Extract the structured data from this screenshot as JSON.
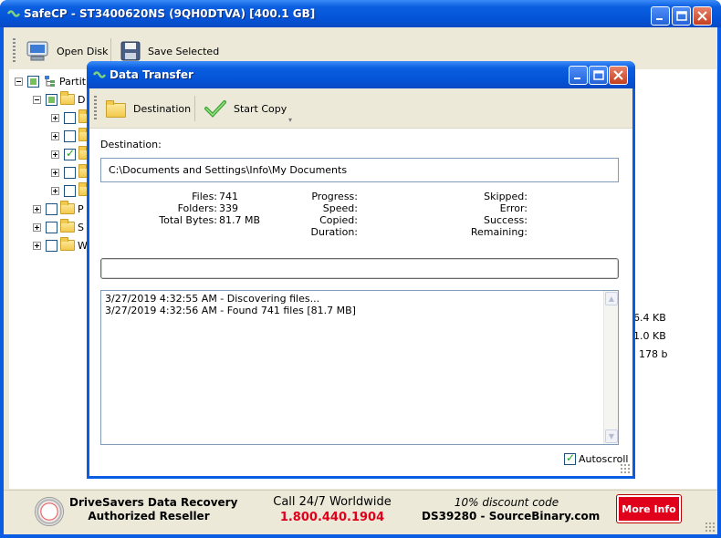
{
  "main_window": {
    "title": "SafeCP - ST3400620NS (9QH0DTVA) [400.1 GB]",
    "toolbar": {
      "open_disk": "Open Disk",
      "save_selected": "Save Selected"
    }
  },
  "tree": {
    "root": "Partit",
    "item_d": "D",
    "item_p": "P",
    "item_s": "S",
    "item_w": "W"
  },
  "sizes": [
    "6.4 KB",
    "1.0 KB",
    "178 b"
  ],
  "dialog": {
    "title": "Data Transfer",
    "toolbar": {
      "destination": "Destination",
      "start_copy": "Start Copy"
    },
    "destination_label": "Destination:",
    "destination_value": "C:\\Documents and Settings\\Info\\My Documents",
    "stats": {
      "files_label": "Files:",
      "files_value": "741",
      "folders_label": "Folders:",
      "folders_value": "339",
      "total_bytes_label": "Total Bytes:",
      "total_bytes_value": "81.7 MB",
      "progress_label": "Progress:",
      "speed_label": "Speed:",
      "copied_label": "Copied:",
      "duration_label": "Duration:",
      "skipped_label": "Skipped:",
      "error_label": "Error:",
      "success_label": "Success:",
      "remaining_label": "Remaining:"
    },
    "progress_fraction": 0,
    "log": [
      "3/27/2019 4:32:55 AM - Discovering files...",
      "3/27/2019 4:32:56 AM - Found 741 files [81.7 MB]"
    ],
    "autoscroll_label": "Autoscroll",
    "autoscroll_checked": true
  },
  "footer": {
    "company_line1": "DriveSavers Data Recovery",
    "company_line2": "Authorized Reseller",
    "call_line": "Call 24/7 Worldwide",
    "phone": "1.800.440.1904",
    "discount_line": "10% discount code",
    "code_line": "DS39280 - SourceBinary.com",
    "more_info": "More Info"
  },
  "colors": {
    "titlebar": "#0a5de3",
    "accent_red": "#e0001b",
    "window_bg": "#ece9d8"
  }
}
